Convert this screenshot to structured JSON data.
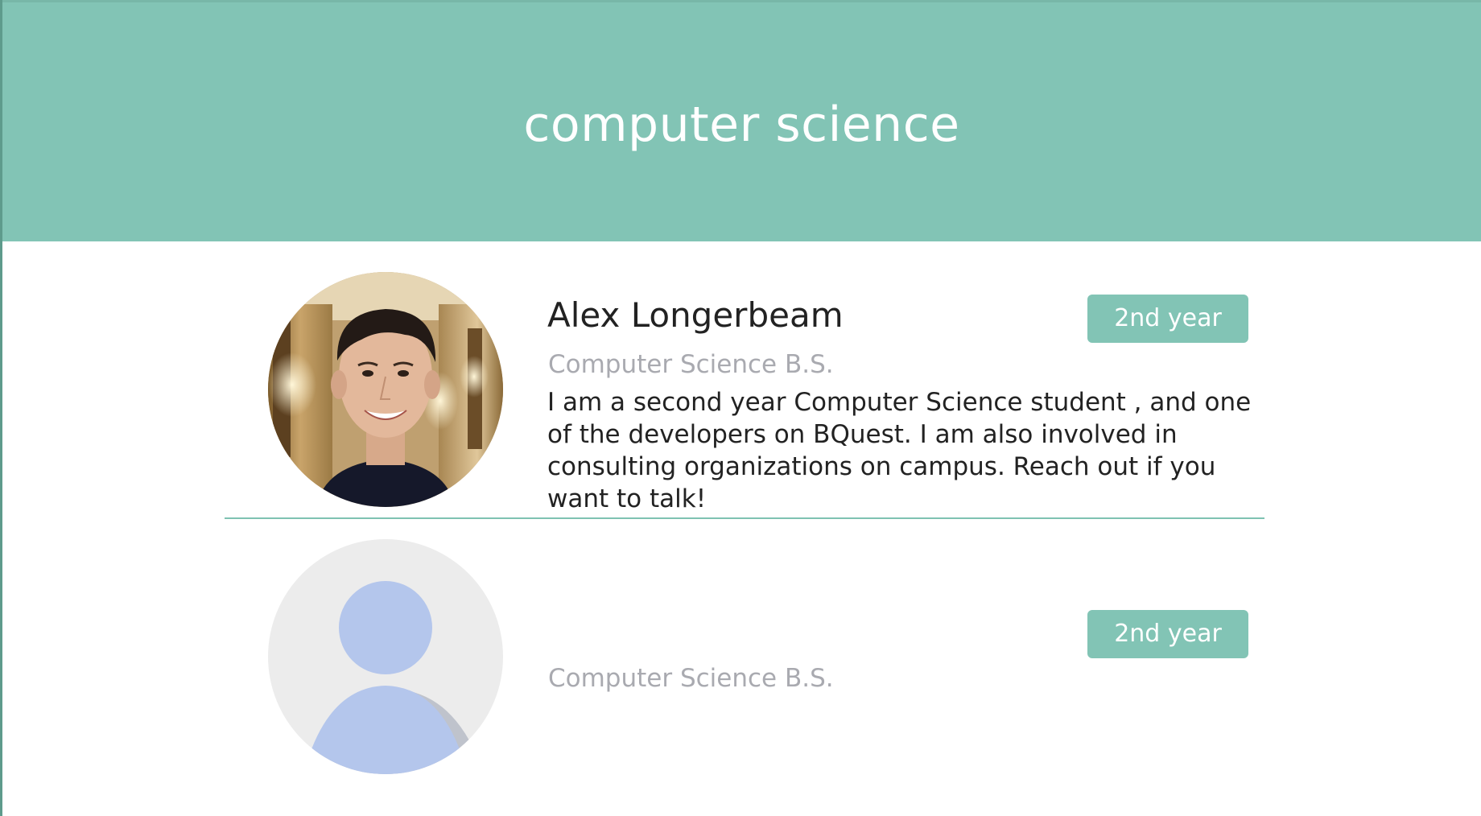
{
  "header": {
    "title": "computer science"
  },
  "profiles": [
    {
      "name": "Alex Longerbeam",
      "major": "Computer Science B.S.",
      "year": "2nd year",
      "bio": "I am a second year Computer Science student , and one of the developers on BQuest. I am also involved in consulting organizations on campus. Reach out if you want to talk!",
      "avatar": "profile-photo"
    },
    {
      "name": "",
      "major": "Computer Science B.S.",
      "year": "2nd year",
      "bio": "",
      "avatar": "default-avatar-icon"
    }
  ],
  "colors": {
    "accent": "#82c4b5",
    "header_text": "#ffffff",
    "muted_text": "#a9aab0",
    "placeholder_bg": "#ececec",
    "placeholder_figure": "#b4c6ec"
  }
}
